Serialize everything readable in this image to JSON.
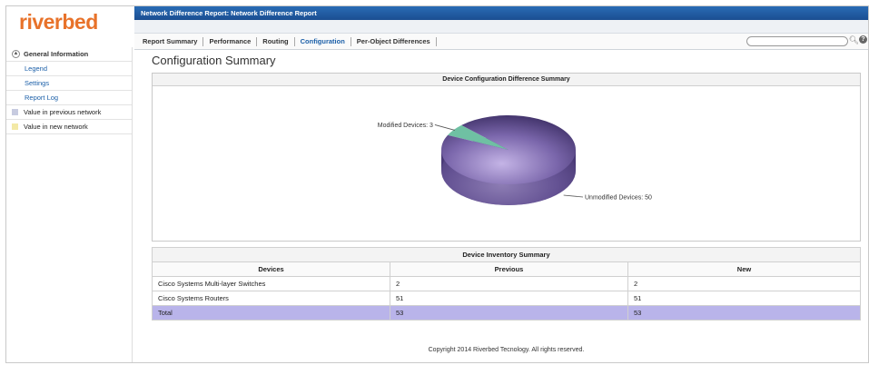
{
  "app": {
    "logo": "riverbed",
    "title": "Network Difference Report: Network Difference Report"
  },
  "tabs": [
    "Report Summary",
    "Performance",
    "Routing",
    "Configuration",
    "Per-Object Differences"
  ],
  "active_tab": "Configuration",
  "search": {
    "value": "",
    "placeholder": ""
  },
  "sidebar": {
    "header": "General Information",
    "links": [
      "Legend",
      "Settings",
      "Report Log"
    ],
    "legend": [
      {
        "label": "Value in previous network",
        "color": "#c7cbe0"
      },
      {
        "label": "Value in new network",
        "color": "#f3e9a6"
      }
    ]
  },
  "main": {
    "page_title": "Configuration Summary",
    "chart_panel_title": "Device Configuration Difference Summary",
    "table": {
      "caption": "Device Inventory Summary",
      "columns": [
        "Devices",
        "Previous",
        "New"
      ],
      "rows": [
        [
          "Cisco Systems Multi-layer Switches",
          "2",
          "2"
        ],
        [
          "Cisco Systems Routers",
          "51",
          "51"
        ],
        [
          "Total",
          "53",
          "53"
        ]
      ]
    },
    "copyright": "Copyright 2014  Riverbed Tecnology. All rights reserved."
  },
  "chart_data": {
    "type": "pie",
    "title": "Device Configuration Difference Summary",
    "slices": [
      {
        "label": "Modified Devices: 3",
        "value": 3,
        "color": "#6fc0a3"
      },
      {
        "label": "Unmodified Devices: 50",
        "value": 50,
        "color": "#6c5a9c"
      }
    ]
  },
  "colors": {
    "title_bar": "#1b4e91",
    "active_tab": "#1b5fa8",
    "logo": "#e8722a",
    "total_row": "#b9b4ea"
  }
}
